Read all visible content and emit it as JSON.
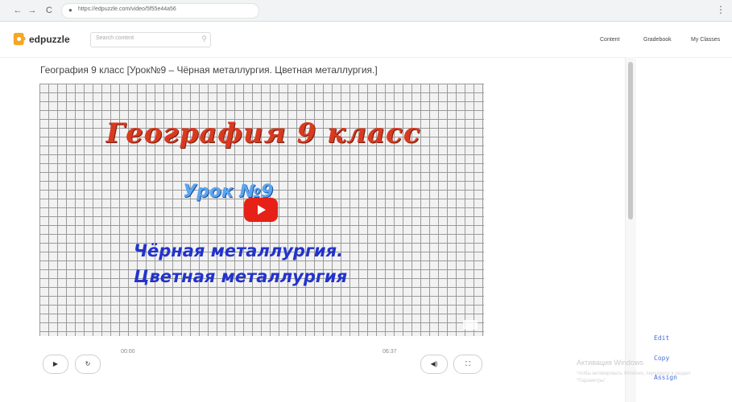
{
  "browser": {
    "url": "https://edpuzzle.com/video/5f55e44a56",
    "nav": {
      "back": "←",
      "forward": "→",
      "reload": "C"
    },
    "menu_glyph": "⋮"
  },
  "header": {
    "logo_text": "edpuzzle",
    "search_placeholder": "Search content",
    "nav": [
      "Content",
      "Gradebook",
      "My Classes"
    ]
  },
  "main": {
    "title": "География 9 класс [Урок№9 – Чёрная металлургия. Цветная металлургия.]",
    "video": {
      "line1": "География 9 класс",
      "line2": "Урок №9",
      "line3": "Чёрная металлургия.",
      "line4": "Цветная металлургия"
    },
    "controls": {
      "play": "▶",
      "rewind": "↻",
      "time_start": "00:00",
      "time_end": "06:37",
      "volume": "◀)",
      "fullscreen": "⛶"
    }
  },
  "side": {
    "links": [
      "Edit",
      "Copy",
      "Assign"
    ]
  },
  "overlay": {
    "title": "Активация Windows",
    "sub_line1": "Чтобы активировать Windows, перейдите в раздел",
    "sub_line2": "\"Параметры\"."
  },
  "colors": {
    "accent_link": "#4a6ee0",
    "youtube_red": "#e62117",
    "title_red": "#d93a1f",
    "lesson_blue": "#5aa6f0",
    "topic_blue": "#2233cc",
    "logo_orange": "#f5a623"
  }
}
